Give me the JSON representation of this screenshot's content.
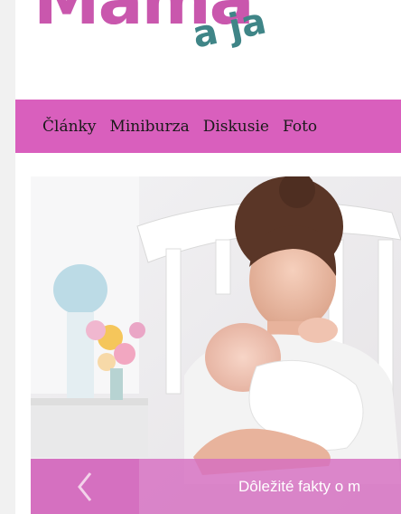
{
  "logo": {
    "main": "Mama",
    "sub": "a ja"
  },
  "nav": {
    "items": [
      {
        "label": "Články"
      },
      {
        "label": "Miniburza"
      },
      {
        "label": "Diskusie"
      },
      {
        "label": "Foto"
      }
    ]
  },
  "slider": {
    "prev_icon": "chevron-left-icon",
    "caption": "Dôležité fakty o m"
  },
  "colors": {
    "brand_pink": "#d95fbd",
    "logo_teal": "#3f8587"
  }
}
